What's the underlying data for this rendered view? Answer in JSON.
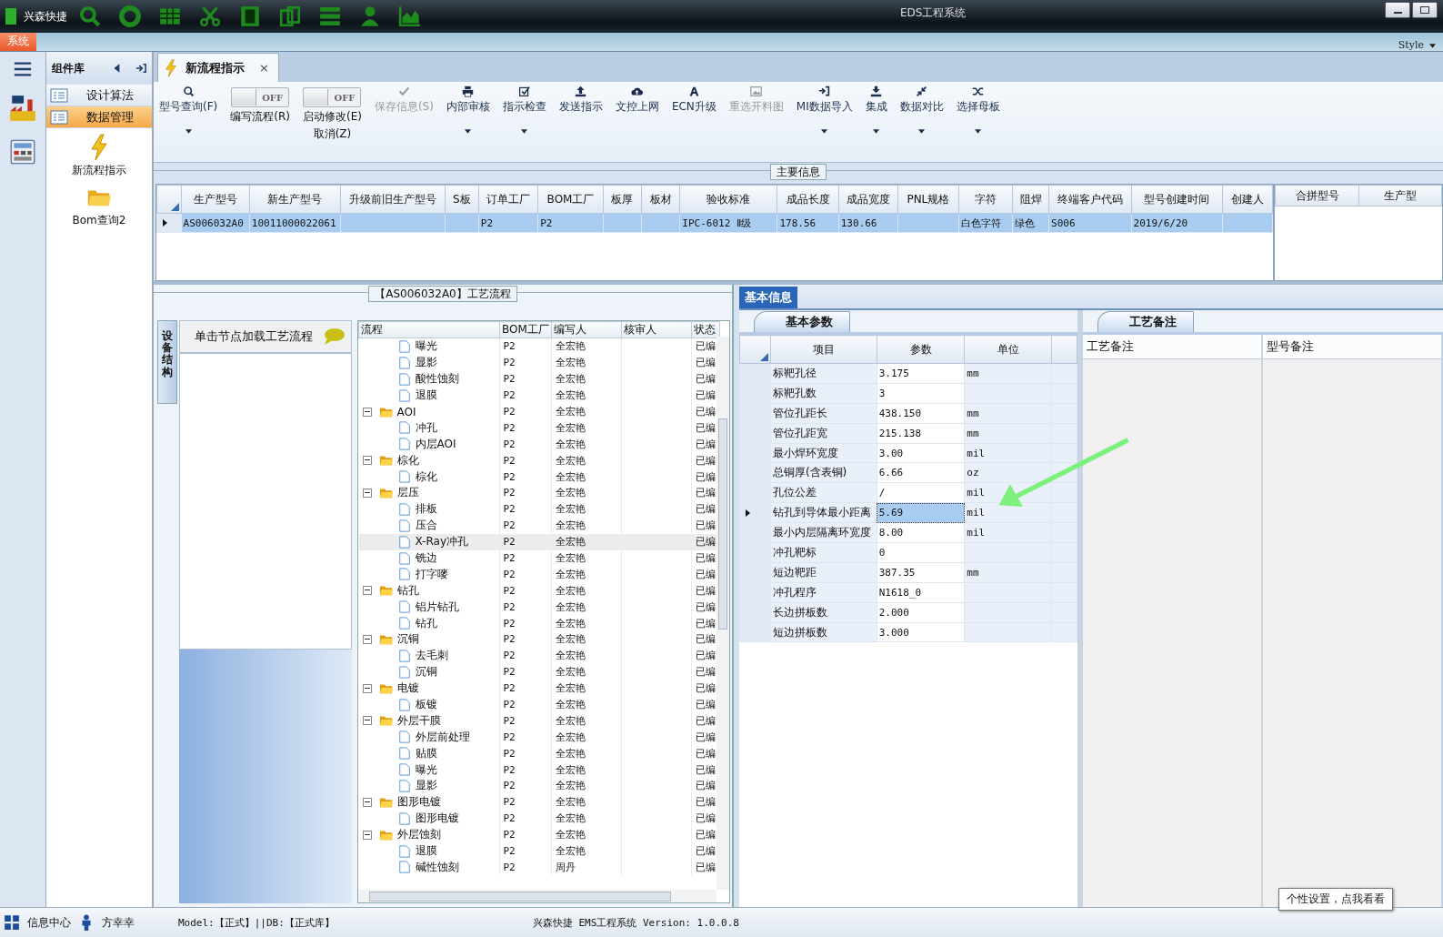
{
  "window": {
    "title": "EDS工程系统",
    "quick_label": "兴森快捷",
    "style_label": "Style"
  },
  "menu": [
    {
      "label": "系统",
      "selected": true
    }
  ],
  "component_panel": {
    "title": "组件库",
    "items": [
      {
        "label": "设计算法",
        "selected": false
      },
      {
        "label": "数据管理",
        "selected": true
      }
    ],
    "tiles": [
      {
        "label": "新流程指示",
        "kind": "bolt"
      },
      {
        "label": "Bom查询2",
        "kind": "folder"
      }
    ]
  },
  "tabs": [
    {
      "label": "新流程指示",
      "selected": true,
      "close": "×"
    }
  ],
  "toolbar": [
    {
      "kind": "button",
      "lines": [
        "型号查询(F)"
      ],
      "has_menu": true,
      "disabled": false
    },
    {
      "kind": "toggle",
      "switch_text": "OFF",
      "on": false,
      "lines": [
        "编写流程(R)"
      ]
    },
    {
      "kind": "toggle",
      "switch_text": "OFF",
      "on": false,
      "lines": [
        "启动修改(E)",
        "取消(Z)"
      ]
    },
    {
      "kind": "button",
      "lines": [
        "保存信息(S)"
      ],
      "has_menu": false,
      "disabled": true
    },
    {
      "kind": "button",
      "lines": [
        "内部审核"
      ],
      "has_menu": true,
      "disabled": false
    },
    {
      "kind": "button",
      "lines": [
        "指示检查"
      ],
      "has_menu": true,
      "disabled": false
    },
    {
      "kind": "button",
      "lines": [
        "发送指示"
      ],
      "has_menu": false,
      "disabled": false
    },
    {
      "kind": "button",
      "lines": [
        "文控上网"
      ],
      "has_menu": false,
      "disabled": false
    },
    {
      "kind": "button",
      "lines": [
        "ECN升级"
      ],
      "has_menu": false,
      "disabled": false
    },
    {
      "kind": "button",
      "lines": [
        "重选开料图"
      ],
      "has_menu": false,
      "disabled": true
    },
    {
      "kind": "button",
      "lines": [
        "MI数据导入"
      ],
      "has_menu": true,
      "disabled": false
    },
    {
      "kind": "button",
      "lines": [
        "集成"
      ],
      "has_menu": true,
      "disabled": false
    },
    {
      "kind": "button",
      "lines": [
        "数据对比"
      ],
      "has_menu": true,
      "disabled": false
    },
    {
      "kind": "button",
      "lines": [
        "选择母板"
      ],
      "has_menu": true,
      "disabled": false
    }
  ],
  "main_info": {
    "title": "主要信息",
    "columns": [
      "生产型号",
      "新生产型号",
      "升级前旧生产型号",
      "S板",
      "订单工厂",
      "BOM工厂",
      "板厚",
      "板材",
      "验收标准",
      "成品长度",
      "成品宽度",
      "PNL规格",
      "字符",
      "阻焊",
      "终端客户代码",
      "型号创建时间",
      "创建人"
    ],
    "rows": [
      {
        "selected": true,
        "cells": [
          "AS006032A0",
          "10011000022061",
          null,
          null,
          "P2",
          "P2",
          null,
          null,
          "IPC-6012 Ⅱ级",
          "178.56",
          "130.66",
          null,
          "白色字符",
          "绿色",
          "S006",
          "2019/6/20",
          null
        ]
      }
    ],
    "side_columns": [
      "合拼型号",
      "生产型"
    ]
  },
  "process": {
    "title": "【AS006032A0】工艺流程",
    "side_tab": "设备结构",
    "hint": "单击节点加载工艺流程",
    "columns": [
      "流程",
      "BOM工厂",
      "编写人",
      "核审人",
      "状态"
    ],
    "tree": [
      {
        "children": [
          {
            "name": "曝光",
            "bom": "P2",
            "author": "全宏艳",
            "status": "已编",
            "selected": false
          },
          {
            "name": "显影",
            "bom": "P2",
            "author": "全宏艳",
            "status": "已编",
            "selected": false
          },
          {
            "name": "酸性蚀刻",
            "bom": "P2",
            "author": "全宏艳",
            "status": "已编",
            "selected": false
          },
          {
            "name": "退膜",
            "bom": "P2",
            "author": "全宏艳",
            "status": "已编",
            "selected": false
          }
        ]
      },
      {
        "name": "AOI",
        "bom": "P2",
        "author": "全宏艳",
        "status": "已编",
        "selected": false,
        "expanded": true,
        "children": [
          {
            "name": "冲孔",
            "bom": "P2",
            "author": "全宏艳",
            "status": "已编",
            "selected": false
          },
          {
            "name": "内层AOI",
            "bom": "P2",
            "author": "全宏艳",
            "status": "已编",
            "selected": false
          }
        ]
      },
      {
        "name": "棕化",
        "bom": "P2",
        "author": "全宏艳",
        "status": "已编",
        "selected": false,
        "expanded": true,
        "children": [
          {
            "name": "棕化",
            "bom": "P2",
            "author": "全宏艳",
            "status": "已编",
            "selected": false
          }
        ]
      },
      {
        "name": "层压",
        "bom": "P2",
        "author": "全宏艳",
        "status": "已编",
        "selected": false,
        "expanded": true,
        "children": [
          {
            "name": "排板",
            "bom": "P2",
            "author": "全宏艳",
            "status": "已编",
            "selected": false
          },
          {
            "name": "压合",
            "bom": "P2",
            "author": "全宏艳",
            "status": "已编",
            "selected": false
          },
          {
            "name": "X-Ray冲孔",
            "bom": "P2",
            "author": "全宏艳",
            "status": "已编",
            "selected": true
          },
          {
            "name": "铣边",
            "bom": "P2",
            "author": "全宏艳",
            "status": "已编",
            "selected": false
          },
          {
            "name": "打字嘜",
            "bom": "P2",
            "author": "全宏艳",
            "status": "已编",
            "selected": false
          }
        ]
      },
      {
        "name": "钻孔",
        "bom": "P2",
        "author": "全宏艳",
        "status": "已编",
        "selected": false,
        "expanded": true,
        "children": [
          {
            "name": "铝片钻孔",
            "bom": "P2",
            "author": "全宏艳",
            "status": "已编",
            "selected": false
          },
          {
            "name": "钻孔",
            "bom": "P2",
            "author": "全宏艳",
            "status": "已编",
            "selected": false
          }
        ]
      },
      {
        "name": "沉铜",
        "bom": "P2",
        "author": "全宏艳",
        "status": "已编",
        "selected": false,
        "expanded": true,
        "children": [
          {
            "name": "去毛刺",
            "bom": "P2",
            "author": "全宏艳",
            "status": "已编",
            "selected": false
          },
          {
            "name": "沉铜",
            "bom": "P2",
            "author": "全宏艳",
            "status": "已编",
            "selected": false
          }
        ]
      },
      {
        "name": "电镀",
        "bom": "P2",
        "author": "全宏艳",
        "status": "已编",
        "selected": false,
        "expanded": true,
        "children": [
          {
            "name": "板镀",
            "bom": "P2",
            "author": "全宏艳",
            "status": "已编",
            "selected": false
          }
        ]
      },
      {
        "name": "外层干膜",
        "bom": "P2",
        "author": "全宏艳",
        "status": "已编",
        "selected": false,
        "expanded": true,
        "children": [
          {
            "name": "外层前处理",
            "bom": "P2",
            "author": "全宏艳",
            "status": "已编",
            "selected": false
          },
          {
            "name": "贴膜",
            "bom": "P2",
            "author": "全宏艳",
            "status": "已编",
            "selected": false
          },
          {
            "name": "曝光",
            "bom": "P2",
            "author": "全宏艳",
            "status": "已编",
            "selected": false
          },
          {
            "name": "显影",
            "bom": "P2",
            "author": "全宏艳",
            "status": "已编",
            "selected": false
          }
        ]
      },
      {
        "name": "图形电镀",
        "bom": "P2",
        "author": "全宏艳",
        "status": "已编",
        "selected": false,
        "expanded": true,
        "children": [
          {
            "name": "图形电镀",
            "bom": "P2",
            "author": "全宏艳",
            "status": "已编",
            "selected": false
          }
        ]
      },
      {
        "name": "外层蚀刻",
        "bom": "P2",
        "author": "全宏艳",
        "status": "已编",
        "selected": false,
        "expanded": true,
        "children": [
          {
            "name": "退膜",
            "bom": "P2",
            "author": "全宏艳",
            "status": "已编",
            "selected": false
          },
          {
            "name": "碱性蚀刻",
            "bom": "P2",
            "author": "周丹",
            "status": "已编",
            "selected": false
          }
        ]
      }
    ]
  },
  "basic_info": {
    "tab": "基本信息",
    "sub_tab": "基本参数",
    "columns": [
      "项目",
      "参数",
      "单位"
    ],
    "rows": [
      {
        "item": "标靶孔径",
        "value": "3.175",
        "unit": "mm",
        "selected": false
      },
      {
        "item": "标靶孔数",
        "value": "3",
        "selected": false
      },
      {
        "item": "管位孔距长",
        "value": "438.150",
        "unit": "mm",
        "selected": false
      },
      {
        "item": "管位孔距宽",
        "value": "215.138",
        "unit": "mm",
        "selected": false
      },
      {
        "item": "最小焊环宽度",
        "value": "3.00",
        "unit": "mil",
        "selected": false
      },
      {
        "item": "总铜厚(含表铜)",
        "value": "6.66",
        "unit": "oz",
        "selected": false
      },
      {
        "item": "孔位公差",
        "value": "/",
        "unit": "mil",
        "selected": false
      },
      {
        "item": "钻孔到导体最小距离",
        "value": "5.69",
        "unit": "mil",
        "selected": true
      },
      {
        "item": "最小内层隔离环宽度",
        "value": "8.00",
        "unit": "mil",
        "selected": false
      },
      {
        "item": "冲孔靶标",
        "value": "0",
        "selected": false
      },
      {
        "item": "短边靶距",
        "value": "387.35",
        "unit": "mm",
        "selected": false
      },
      {
        "item": "冲孔程序",
        "value": "N1618_0",
        "selected": false
      },
      {
        "item": "长边拼板数",
        "value": "2.000",
        "selected": false
      },
      {
        "item": "短边拼板数",
        "value": "3.000",
        "selected": false
      }
    ]
  },
  "notes": {
    "tab": "工艺备注",
    "columns": [
      "工艺备注",
      "型号备注"
    ]
  },
  "tooltip": "个性设置，点我看看",
  "status_bar": {
    "info": "信息中心",
    "user": "方幸幸",
    "model": "Model:【正式】||DB:【正式库】",
    "version": "兴森快捷 EMS工程系统 Version: 1.0.0.8"
  }
}
